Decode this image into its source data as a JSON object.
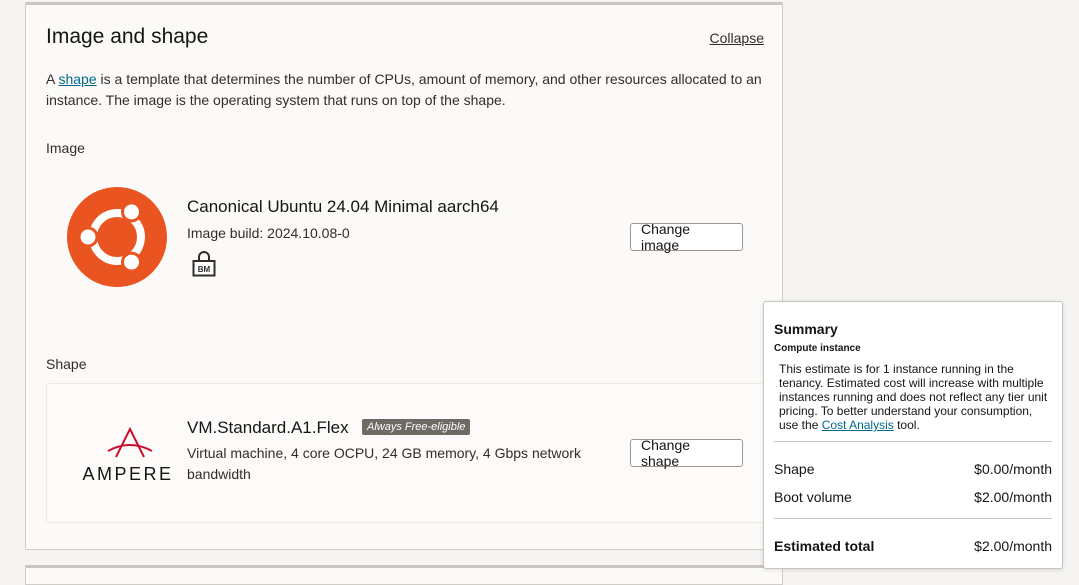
{
  "card": {
    "title": "Image and shape",
    "collapse_label": "Collapse",
    "description_prefix": "A",
    "description_link": "shape",
    "description_suffix": "is a template that determines the number of CPUs, amount of memory, and other resources allocated to an instance. The image is the operating system that runs on top of the shape."
  },
  "image": {
    "section_label": "Image",
    "logo_icon": "ubuntu-logo-icon",
    "name": "Canonical Ubuntu 24.04 Minimal aarch64",
    "build": "Image build: 2024.10.08-0",
    "bm_icon": "bm-lock-icon",
    "bm_text": "BM",
    "change_label": "Change image"
  },
  "shape": {
    "section_label": "Shape",
    "logo_text": "AMPERE",
    "name": "VM.Standard.A1.Flex",
    "badge": "Always Free-eligible",
    "description": "Virtual machine, 4 core OCPU, 24 GB memory, 4 Gbps network bandwidth",
    "change_label": "Change shape"
  },
  "summary": {
    "title": "Summary",
    "subtitle": "Compute instance",
    "text_prefix": "This estimate is for 1 instance running in the tenancy. Estimated cost will increase with multiple instances running and does not reflect any tier unit pricing. To better understand your consumption, use the",
    "text_link": "Cost Analysis",
    "text_suffix": "tool.",
    "rows": [
      {
        "label": "Shape",
        "value": "$0.00/month"
      },
      {
        "label": "Boot volume",
        "value": "$2.00/month"
      }
    ],
    "total_label": "Estimated total",
    "total_value": "$2.00/month"
  },
  "colors": {
    "ubuntu_orange": "#e95420",
    "ampere_red": "#c8102e",
    "link": "#00688c"
  }
}
